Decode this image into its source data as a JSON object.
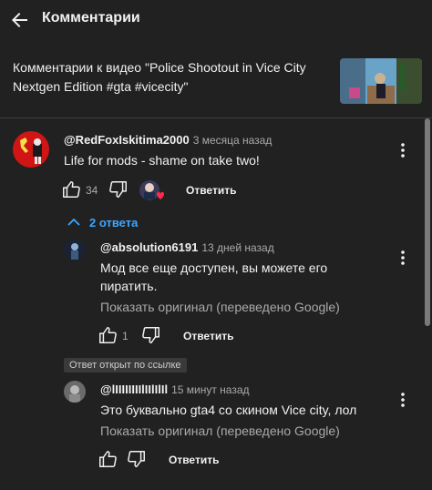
{
  "header": {
    "title": "Комментарии"
  },
  "video": {
    "title": "Комментарии к видео \"Police Shootout in Vice City Nextgen Edition #gta #vicecity\""
  },
  "colors": {
    "background": "#212121",
    "accent_link": "#3ea6ff",
    "secondary_text": "#aaaaaa"
  },
  "comment": {
    "author": "@RedFoxIskitima2000",
    "time": "3 месяца назад",
    "text": "Life for mods - shame on take two!",
    "likes": "34",
    "reply_label": "Ответить"
  },
  "replies_toggle": {
    "label": "2 ответа"
  },
  "reply1": {
    "author": "@absolution6191",
    "time": "13 дней назад",
    "text_line1": "Мод все еще доступен, вы можете его",
    "text_line2": "пиратить.",
    "translate": "Показать оригинал (переведено Google)",
    "likes": "1",
    "reply_label": "Ответить"
  },
  "linked_badge": "Ответ открыт по ссылке",
  "reply2": {
    "author": "@lIIIIIIIIlIIlIlIl",
    "time": "15 минут назад",
    "text": "Это буквально gta4 со скином Vice city, лол",
    "translate": "Показать оригинал (переведено Google)",
    "reply_label": "Ответить"
  }
}
